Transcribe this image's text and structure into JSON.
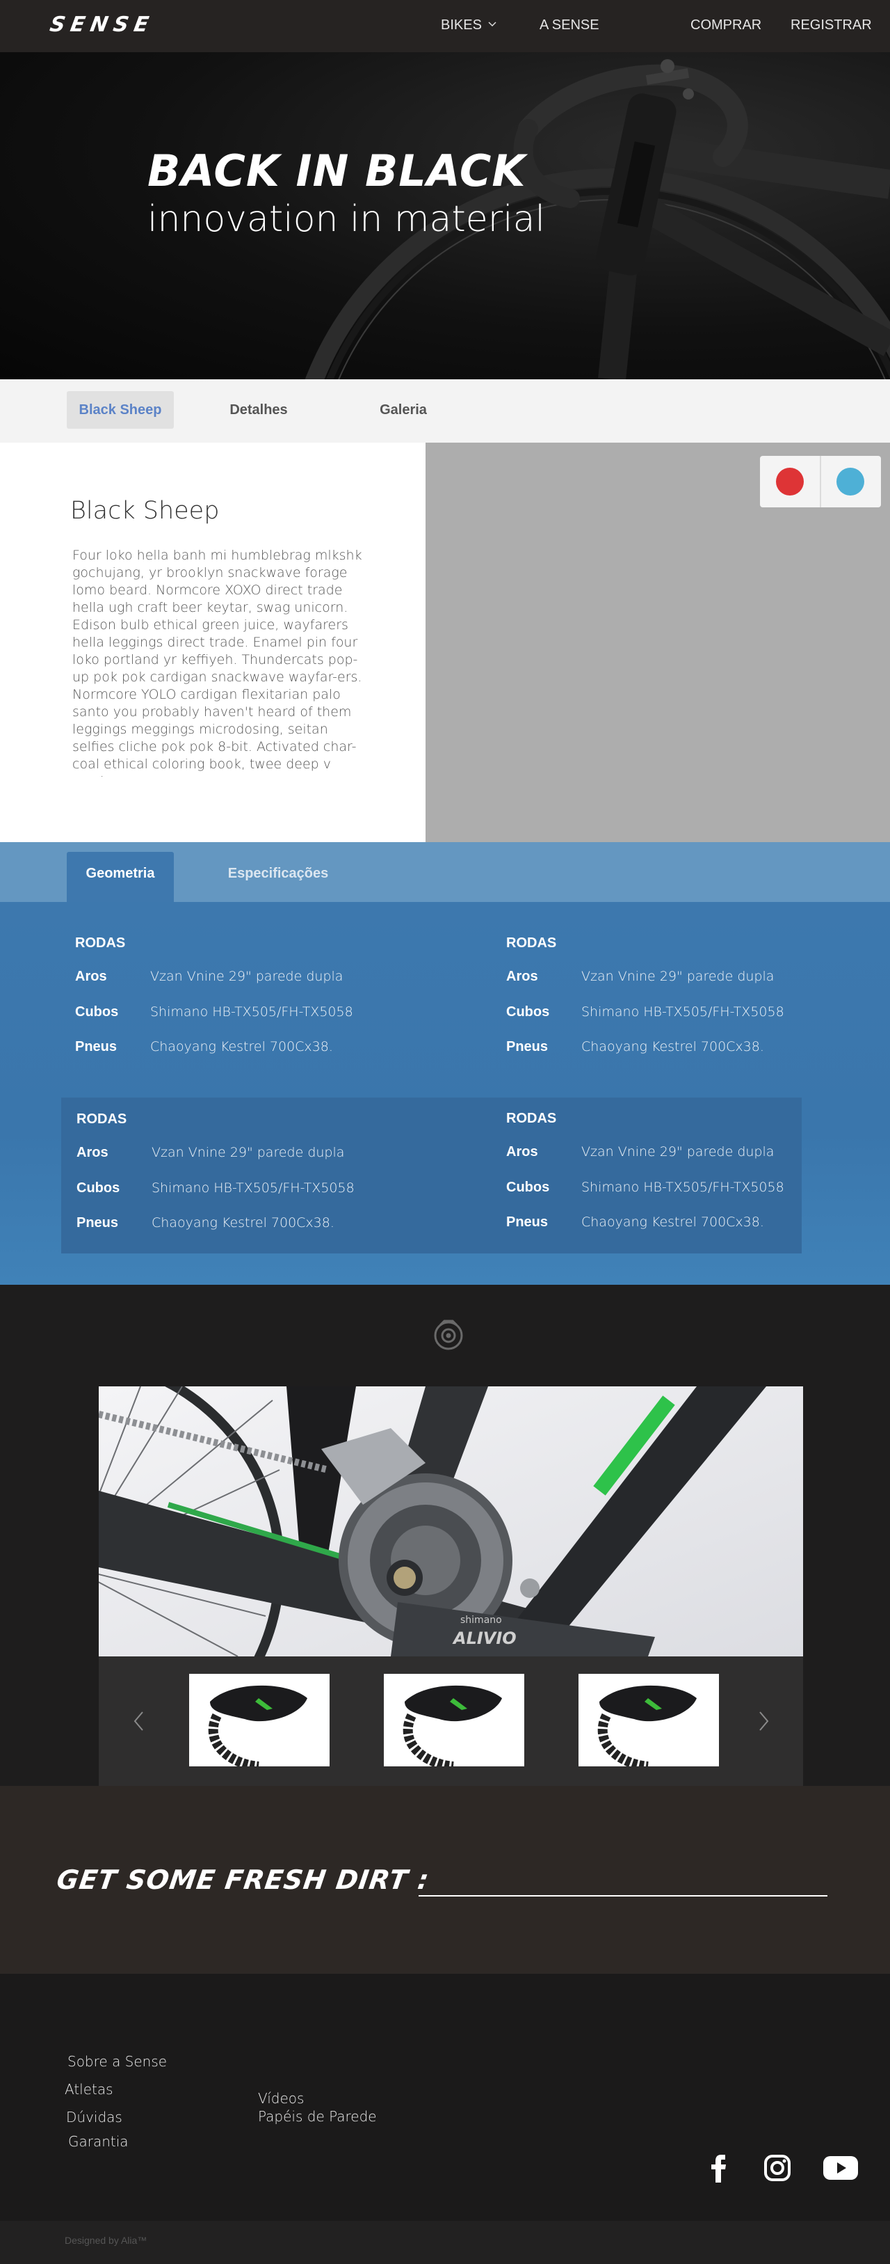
{
  "nav": {
    "logo": "SENSE",
    "links": [
      "BIKES",
      "A SENSE",
      "COMPRAR",
      "REGISTRAR"
    ]
  },
  "hero": {
    "title": "BACK IN BLACK",
    "subtitle": "innovation in material"
  },
  "product_tabs": [
    "Black Sheep",
    "Detalhes",
    "Galeria"
  ],
  "description": {
    "title": "Black Sheep",
    "body": "Four loko hella banh mi humblebrag mlkshk gochujang, yr brooklyn snackwave forage lomo beard.  Normcore XOXO direct trade hella ugh craft beer keytar, swag unicorn. Edison bulb ethical green juice, wayfarers hella leggings direct trade.  Enamel pin four loko portland yr keffiyeh.  Thundercats pop-up pok pok cardigan snackwave wayfar-ers.  Normcore YOLO cardigan flexitarian palo santo you probably haven't heard of them leggings meggings microdosing, seitan selfies cliche pok pok 8-bit.  Activated char-coal ethical coloring book, twee deep v semi-"
  },
  "colors": [
    "#de3436",
    "#4eb0d6"
  ],
  "spec_tabs": [
    "Geometria",
    "Especificações"
  ],
  "spec_groups": [
    {
      "heading": "RODAS",
      "rows": [
        {
          "k": "Aros",
          "v": "Vzan Vnine 29\" parede dupla"
        },
        {
          "k": "Cubos",
          "v": "Shimano HB-TX505/FH-TX5058"
        },
        {
          "k": "Pneus",
          "v": "Chaoyang Kestrel 700Cx38."
        }
      ]
    },
    {
      "heading": "RODAS",
      "rows": [
        {
          "k": "Aros",
          "v": "Vzan Vnine 29\" parede dupla"
        },
        {
          "k": "Cubos",
          "v": "Shimano HB-TX505/FH-TX5058"
        },
        {
          "k": "Pneus",
          "v": "Chaoyang Kestrel 700Cx38."
        }
      ]
    },
    {
      "heading": "RODAS",
      "rows": [
        {
          "k": "Aros",
          "v": "Vzan Vnine 29\" parede dupla"
        },
        {
          "k": "Cubos",
          "v": "Shimano HB-TX505/FH-TX5058"
        },
        {
          "k": "Pneus",
          "v": "Chaoyang Kestrel 700Cx38."
        }
      ]
    },
    {
      "heading": "RODAS",
      "rows": [
        {
          "k": "Aros",
          "v": "Vzan Vnine 29\" parede dupla"
        },
        {
          "k": "Cubos",
          "v": "Shimano HB-TX505/FH-TX5058"
        },
        {
          "k": "Pneus",
          "v": "Chaoyang Kestrel 700Cx38."
        }
      ]
    }
  ],
  "gallery": {
    "crank_brand": "shimano",
    "crank_model": "ALIVIO"
  },
  "newsletter": {
    "title": "GET SOME FRESH DIRT :"
  },
  "footer": {
    "links_col1": [
      "Sobre a Sense",
      "Atletas",
      "Dúvidas",
      "Garantia"
    ],
    "links_col2": [
      "Vídeos",
      "Papéis de Parede"
    ],
    "social": [
      "facebook-icon",
      "instagram-icon",
      "youtube-icon"
    ],
    "copyright": "Designed by Alia™"
  }
}
